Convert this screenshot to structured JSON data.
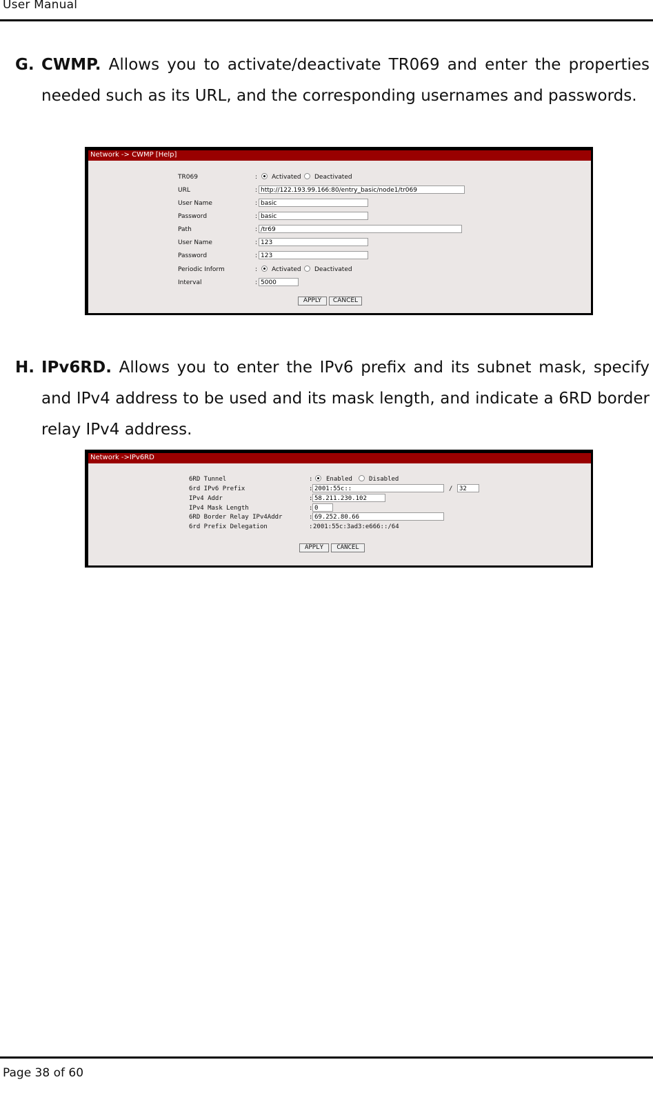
{
  "header": {
    "title": "User Manual"
  },
  "sections": [
    {
      "letter": "G.",
      "term": "CWMP.",
      "text": " Allows you to activate/deactivate TR069 and enter the properties needed such as its URL, and the corresponding usernames and passwords."
    },
    {
      "letter": "H.",
      "term": "IPv6RD.",
      "text": " Allows you to enter the IPv6 prefix and its subnet mask, specify and IPv4 address to be used and its mask length, and indicate a 6RD border relay IPv4 address."
    }
  ],
  "cwmp": {
    "title": "Network -> CWMP [Help]",
    "colon": ":",
    "tr069": {
      "label": "TR069",
      "options": [
        "Activated",
        "Deactivated"
      ],
      "selected": "Activated"
    },
    "url": {
      "label": "URL",
      "value": "http://122.193.99.166:80/entry_basic/node1/tr069"
    },
    "username1": {
      "label": "User Name",
      "value": "basic"
    },
    "password1": {
      "label": "Password",
      "value": "basic"
    },
    "path": {
      "label": "Path",
      "value": "/tr69"
    },
    "username2": {
      "label": "User Name",
      "value": "123"
    },
    "password2": {
      "label": "Password",
      "value": "123"
    },
    "periodic": {
      "label": "Periodic Inform",
      "options": [
        "Activated",
        "Deactivated"
      ],
      "selected": "Activated"
    },
    "interval": {
      "label": "Interval",
      "value": "5000"
    },
    "apply": "APPLY",
    "cancel": "CANCEL"
  },
  "ipv6rd": {
    "title": "Network ->IPv6RD",
    "colon": ":",
    "tunnel": {
      "label": "6RD Tunnel",
      "options": [
        "Enabled",
        "Disabled"
      ],
      "selected": "Enabled"
    },
    "prefix": {
      "label": "6rd IPv6 Prefix",
      "value": "2001:55c::",
      "separator": "/",
      "length": "32"
    },
    "ipv4addr": {
      "label": "IPv4 Addr",
      "value": "58.211.230.102"
    },
    "masklen": {
      "label": "IPv4 Mask Length",
      "value": "0"
    },
    "relay": {
      "label": "6RD Border Relay IPv4Addr",
      "value": "69.252.80.66"
    },
    "delegation": {
      "label": "6rd Prefix Delegation",
      "value": "2001:55c:3ad3:e666::/64"
    },
    "apply": "APPLY",
    "cancel": "CANCEL"
  },
  "footer": {
    "page": "Page 38 of 60"
  },
  "colors": {
    "title_bar": "#990000",
    "panel_bg": "#ebe7e6"
  }
}
